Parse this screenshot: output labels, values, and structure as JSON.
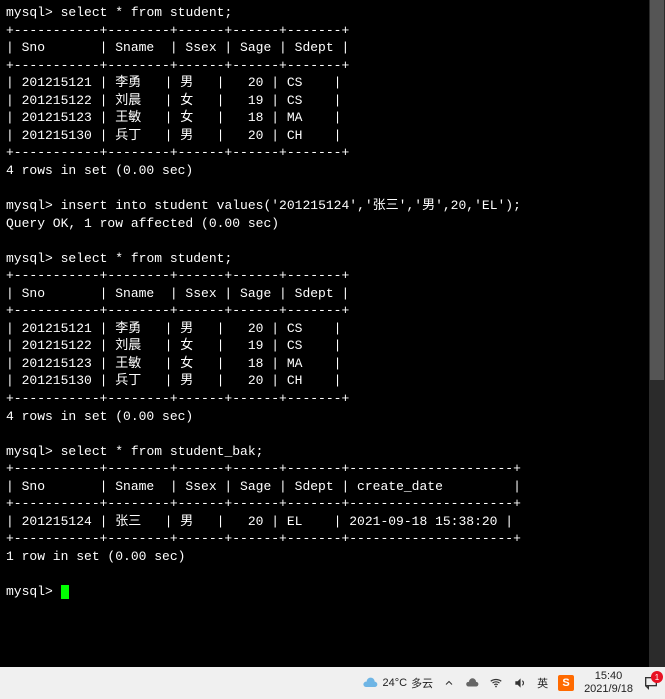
{
  "terminal": {
    "prompt": "mysql>",
    "queries": {
      "select1": "select * from student;",
      "insert": "insert into student values('201215124','张三','男',20,'EL');",
      "insert_result": "Query OK, 1 row affected (0.00 sec)",
      "select2": "select * from student;",
      "select3": "select * from student_bak;"
    },
    "table1": {
      "border_top": "+-----------+--------+------+------+-------+",
      "header": "| Sno       | Sname  | Ssex | Sage | Sdept |",
      "rows": [
        "| 201215121 | 李勇   | 男   |   20 | CS    |",
        "| 201215122 | 刘晨   | 女   |   19 | CS    |",
        "| 201215123 | 王敏   | 女   |   18 | MA    |",
        "| 201215130 | 兵丁   | 男   |   20 | CH    |"
      ],
      "footer": "4 rows in set (0.00 sec)"
    },
    "table2": {
      "border_top": "+-----------+--------+------+------+-------+",
      "header": "| Sno       | Sname  | Ssex | Sage | Sdept |",
      "rows": [
        "| 201215121 | 李勇   | 男   |   20 | CS    |",
        "| 201215122 | 刘晨   | 女   |   19 | CS    |",
        "| 201215123 | 王敏   | 女   |   18 | MA    |",
        "| 201215130 | 兵丁   | 男   |   20 | CH    |"
      ],
      "footer": "4 rows in set (0.00 sec)"
    },
    "table3": {
      "border_top": "+-----------+--------+------+------+-------+---------------------+",
      "header": "| Sno       | Sname  | Ssex | Sage | Sdept | create_date         |",
      "rows": [
        "| 201215124 | 张三   | 男   |   20 | EL    | 2021-09-18 15:38:20 |"
      ],
      "footer": "1 row in set (0.00 sec)"
    }
  },
  "taskbar": {
    "weather_temp": "24°C",
    "weather_desc": "多云",
    "ime_lang": "英",
    "ime_brand": "S",
    "time": "15:40",
    "date": "2021/9/18",
    "notif_count": "1"
  },
  "chart_data": [
    {
      "type": "table",
      "title": "student",
      "columns": [
        "Sno",
        "Sname",
        "Ssex",
        "Sage",
        "Sdept"
      ],
      "rows": [
        [
          "201215121",
          "李勇",
          "男",
          20,
          "CS"
        ],
        [
          "201215122",
          "刘晨",
          "女",
          19,
          "CS"
        ],
        [
          "201215123",
          "王敏",
          "女",
          18,
          "MA"
        ],
        [
          "201215130",
          "兵丁",
          "男",
          20,
          "CH"
        ]
      ]
    },
    {
      "type": "table",
      "title": "student (after insert)",
      "columns": [
        "Sno",
        "Sname",
        "Ssex",
        "Sage",
        "Sdept"
      ],
      "rows": [
        [
          "201215121",
          "李勇",
          "男",
          20,
          "CS"
        ],
        [
          "201215122",
          "刘晨",
          "女",
          19,
          "CS"
        ],
        [
          "201215123",
          "王敏",
          "女",
          18,
          "MA"
        ],
        [
          "201215130",
          "兵丁",
          "男",
          20,
          "CH"
        ]
      ]
    },
    {
      "type": "table",
      "title": "student_bak",
      "columns": [
        "Sno",
        "Sname",
        "Ssex",
        "Sage",
        "Sdept",
        "create_date"
      ],
      "rows": [
        [
          "201215124",
          "张三",
          "男",
          20,
          "EL",
          "2021-09-18 15:38:20"
        ]
      ]
    }
  ]
}
